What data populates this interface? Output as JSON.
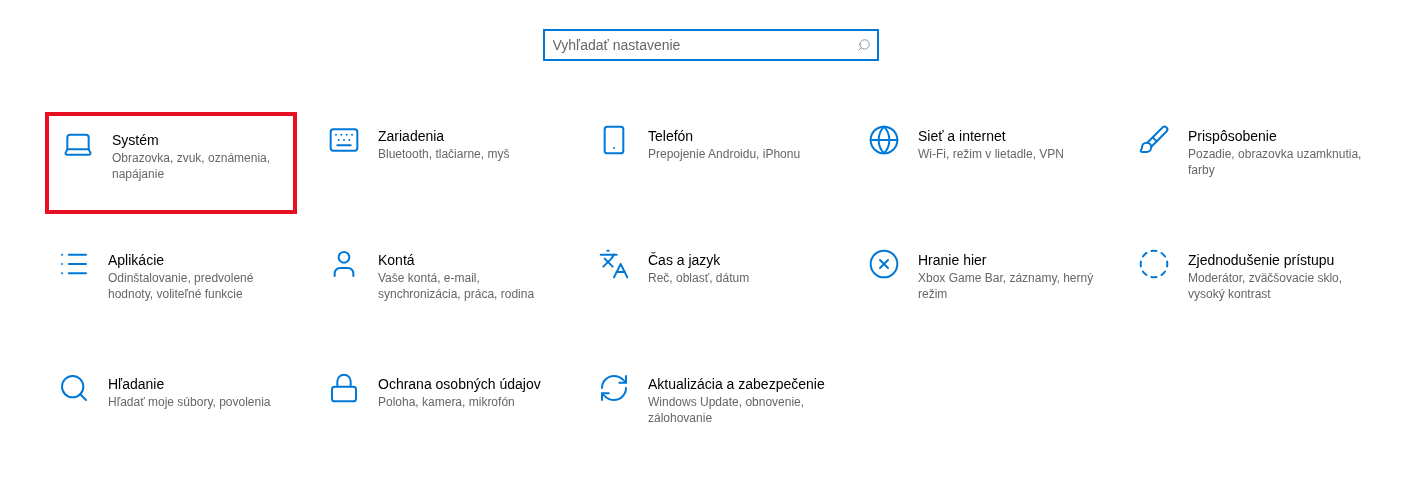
{
  "search": {
    "placeholder": "Vyhľadať nastavenie"
  },
  "categories": [
    {
      "kind": "laptop",
      "title": "Systém",
      "description": "Obrazovka, zvuk, oznámenia, napájanie",
      "highlighted": true
    },
    {
      "kind": "devices",
      "title": "Zariadenia",
      "description": "Bluetooth, tlačiarne, myš",
      "highlighted": false
    },
    {
      "kind": "phone",
      "title": "Telefón",
      "description": "Prepojenie Androidu, iPhonu",
      "highlighted": false
    },
    {
      "kind": "globe",
      "title": "Sieť a internet",
      "description": "Wi-Fi, režim v lietadle, VPN",
      "highlighted": false
    },
    {
      "kind": "paint",
      "title": "Prispôsobenie",
      "description": "Pozadie, obrazovka uzamknutia, farby",
      "highlighted": false
    },
    {
      "kind": "apps",
      "title": "Aplikácie",
      "description": "Odinštalovanie, predvolené hodnoty, voliteľné funkcie",
      "highlighted": false
    },
    {
      "kind": "person",
      "title": "Kontá",
      "description": "Vaše kontá, e-mail, synchronizácia, práca, rodina",
      "highlighted": false
    },
    {
      "kind": "language",
      "title": "Čas a jazyk",
      "description": "Reč, oblasť, dátum",
      "highlighted": false
    },
    {
      "kind": "gaming",
      "title": "Hranie hier",
      "description": "Xbox Game Bar, záznamy, herný režim",
      "highlighted": false
    },
    {
      "kind": "access",
      "title": "Zjednodušenie prístupu",
      "description": "Moderátor, zväčšovacie sklo, vysoký kontrast",
      "highlighted": false
    },
    {
      "kind": "search",
      "title": "Hľadanie",
      "description": "Hľadať moje súbory, povolenia",
      "highlighted": false
    },
    {
      "kind": "lock",
      "title": "Ochrana osobných údajov",
      "description": "Poloha, kamera, mikrofón",
      "highlighted": false
    },
    {
      "kind": "update",
      "title": "Aktualizácia a zabezpečenie",
      "description": "Windows Update, obnovenie, zálohovanie",
      "highlighted": false
    }
  ]
}
